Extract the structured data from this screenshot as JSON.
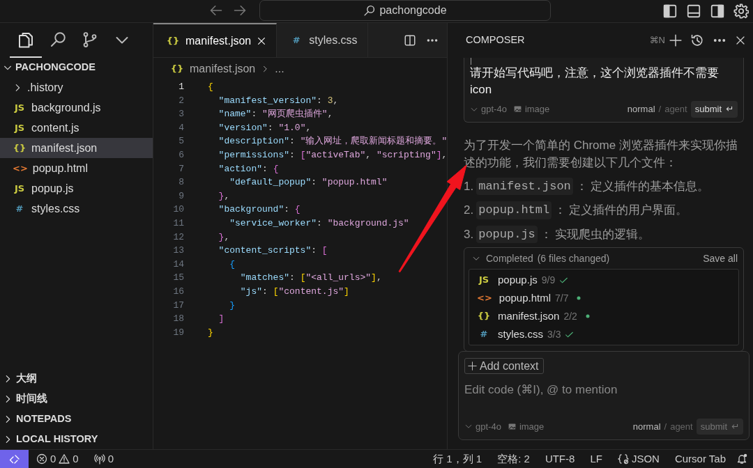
{
  "title_bar": {
    "search": "pachongcode"
  },
  "activity": [
    {
      "kind": "explorer",
      "selected": true
    },
    {
      "kind": "search",
      "selected": false
    },
    {
      "kind": "source-control",
      "selected": false
    },
    {
      "kind": "more",
      "selected": false
    }
  ],
  "explorer": {
    "title": "PACHONGCODE",
    "items": [
      {
        "label": ".history",
        "kind": "folder",
        "selected": false
      },
      {
        "label": "background.js",
        "kind": "js",
        "icon": "JS",
        "selected": false
      },
      {
        "label": "content.js",
        "kind": "js",
        "icon": "JS",
        "selected": false
      },
      {
        "label": "manifest.json",
        "kind": "json",
        "icon": "{}",
        "selected": true
      },
      {
        "label": "popup.html",
        "kind": "html",
        "icon": "<>",
        "selected": false
      },
      {
        "label": "popup.js",
        "kind": "js",
        "icon": "JS",
        "selected": false
      },
      {
        "label": "styles.css",
        "kind": "css",
        "icon": "#",
        "selected": false
      }
    ]
  },
  "panels": [
    "大纲",
    "时间线",
    "NOTEPADS",
    "LOCAL HISTORY"
  ],
  "editor": {
    "tabs": [
      {
        "label": "manifest.json",
        "kind": "json",
        "icon": "{}",
        "selected": true
      },
      {
        "label": "styles.css",
        "kind": "css",
        "icon": "#",
        "selected": false
      }
    ],
    "breadcrumb": {
      "icon": "{}",
      "kind": "json",
      "file": "manifest.json",
      "more": "..."
    },
    "lines": [
      {
        "number": "1",
        "tokens": [
          {
            "text": "{",
            "kind": "b1"
          }
        ]
      },
      {
        "number": "2",
        "tokens": [
          {
            "text": "  \"manifest_version\"",
            "kind": "key"
          },
          {
            "text": ": ",
            "kind": "p"
          },
          {
            "text": "3",
            "kind": "num"
          },
          {
            "text": ",",
            "kind": "p"
          }
        ]
      },
      {
        "number": "3",
        "tokens": [
          {
            "text": "  \"name\"",
            "kind": "key"
          },
          {
            "text": ": ",
            "kind": "p"
          },
          {
            "text": "\"网页爬虫插件\"",
            "kind": "str"
          },
          {
            "text": ",",
            "kind": "p"
          }
        ]
      },
      {
        "number": "4",
        "tokens": [
          {
            "text": "  \"version\"",
            "kind": "key"
          },
          {
            "text": ": ",
            "kind": "p"
          },
          {
            "text": "\"1.0\"",
            "kind": "str"
          },
          {
            "text": ",",
            "kind": "p"
          }
        ]
      },
      {
        "number": "5",
        "tokens": [
          {
            "text": "  \"description\"",
            "kind": "key"
          },
          {
            "text": ": ",
            "kind": "p"
          },
          {
            "text": "\"输入网址，爬取新闻标题和摘要。\"",
            "kind": "str"
          }
        ]
      },
      {
        "number": "6",
        "tokens": [
          {
            "text": "  \"permissions\"",
            "kind": "key"
          },
          {
            "text": ": ",
            "kind": "p"
          },
          {
            "text": "[",
            "kind": "b2"
          },
          {
            "text": "\"activeTab\"",
            "kind": "str"
          },
          {
            "text": ", ",
            "kind": "p"
          },
          {
            "text": "\"scripting\"",
            "kind": "str"
          },
          {
            "text": "]",
            "kind": "b2"
          },
          {
            "text": ",",
            "kind": "p"
          }
        ]
      },
      {
        "number": "7",
        "tokens": [
          {
            "text": "  \"action\"",
            "kind": "key"
          },
          {
            "text": ": ",
            "kind": "p"
          },
          {
            "text": "{",
            "kind": "b2"
          }
        ]
      },
      {
        "number": "8",
        "tokens": [
          {
            "text": "    \"default_popup\"",
            "kind": "key"
          },
          {
            "text": ": ",
            "kind": "p"
          },
          {
            "text": "\"popup.html\"",
            "kind": "str"
          }
        ]
      },
      {
        "number": "9",
        "tokens": [
          {
            "text": "  }",
            "kind": "b2"
          },
          {
            "text": ",",
            "kind": "p"
          }
        ]
      },
      {
        "number": "10",
        "tokens": [
          {
            "text": "  \"background\"",
            "kind": "key"
          },
          {
            "text": ": ",
            "kind": "p"
          },
          {
            "text": "{",
            "kind": "b2"
          }
        ]
      },
      {
        "number": "11",
        "tokens": [
          {
            "text": "    \"service_worker\"",
            "kind": "key"
          },
          {
            "text": ": ",
            "kind": "p"
          },
          {
            "text": "\"background.js\"",
            "kind": "str"
          }
        ]
      },
      {
        "number": "12",
        "tokens": [
          {
            "text": "  }",
            "kind": "b2"
          },
          {
            "text": ",",
            "kind": "p"
          }
        ]
      },
      {
        "number": "13",
        "tokens": [
          {
            "text": "  \"content_scripts\"",
            "kind": "key"
          },
          {
            "text": ": ",
            "kind": "p"
          },
          {
            "text": "[",
            "kind": "b2"
          }
        ]
      },
      {
        "number": "14",
        "tokens": [
          {
            "text": "    {",
            "kind": "b3"
          }
        ]
      },
      {
        "number": "15",
        "tokens": [
          {
            "text": "      \"matches\"",
            "kind": "key"
          },
          {
            "text": ": ",
            "kind": "p"
          },
          {
            "text": "[",
            "kind": "b1"
          },
          {
            "text": "\"<all_urls>\"",
            "kind": "str"
          },
          {
            "text": "]",
            "kind": "b1"
          },
          {
            "text": ",",
            "kind": "p"
          }
        ]
      },
      {
        "number": "16",
        "tokens": [
          {
            "text": "      \"js\"",
            "kind": "key"
          },
          {
            "text": ": ",
            "kind": "p"
          },
          {
            "text": "[",
            "kind": "b1"
          },
          {
            "text": "\"content.js\"",
            "kind": "str"
          },
          {
            "text": "]",
            "kind": "b1"
          }
        ]
      },
      {
        "number": "17",
        "tokens": [
          {
            "text": "    }",
            "kind": "b3"
          }
        ]
      },
      {
        "number": "18",
        "tokens": [
          {
            "text": "  ]",
            "kind": "b2"
          }
        ]
      },
      {
        "number": "19",
        "tokens": [
          {
            "text": "}",
            "kind": "b1"
          }
        ]
      }
    ]
  },
  "composer": {
    "title": "COMPOSER",
    "shortcut": "⌘N",
    "message": {
      "text": "请开始写代码吧，注意，这个浏览器插件不需要icon",
      "model": "gpt-4o",
      "attach": "image",
      "mode": "normal",
      "separator": "/",
      "alt_mode": "agent",
      "submit": "submit",
      "submit_disabled": false
    },
    "answer": {
      "intro": "为了开发一个简单的 Chrome 浏览器插件来实现你描述的功能，我们需要创建以下几个文件：",
      "steps": [
        {
          "number": "1.",
          "code": "manifest.json",
          "colon": "：",
          "text": "定义插件的基本信息。"
        },
        {
          "number": "2.",
          "code": "popup.html",
          "colon": "：",
          "text": "定义插件的用户界面。"
        },
        {
          "number": "3.",
          "code": "popup.js",
          "colon": "：",
          "text": "实现爬虫的逻辑。"
        }
      ]
    },
    "changes": {
      "title": "Completed",
      "count": "(6 files changed)",
      "action": "Save all",
      "files": [
        {
          "name": "popup.js",
          "kind": "js",
          "icon": "JS",
          "progress": "9/9",
          "saved": true
        },
        {
          "name": "popup.html",
          "kind": "html",
          "icon": "<>",
          "progress": "7/7",
          "saved": false
        },
        {
          "name": "manifest.json",
          "kind": "json",
          "icon": "{}",
          "progress": "2/2",
          "saved": false
        },
        {
          "name": "styles.css",
          "kind": "css",
          "icon": "#",
          "progress": "3/3",
          "saved": true
        }
      ]
    },
    "input": {
      "add_context": "Add context",
      "placeholder": "Edit code (⌘I), @ to mention",
      "model": "gpt-4o",
      "attach": "image",
      "mode": "normal",
      "separator": "/",
      "alt_mode": "agent",
      "submit": "submit",
      "submit_disabled": true
    }
  },
  "status_bar": {
    "errors": "0",
    "warnings": "0",
    "ports": "0",
    "position": "行 1，列 1",
    "indent": "空格: 2",
    "encoding": "UTF-8",
    "eol": "LF",
    "language": "JSON",
    "extension": "Cursor Tab"
  }
}
